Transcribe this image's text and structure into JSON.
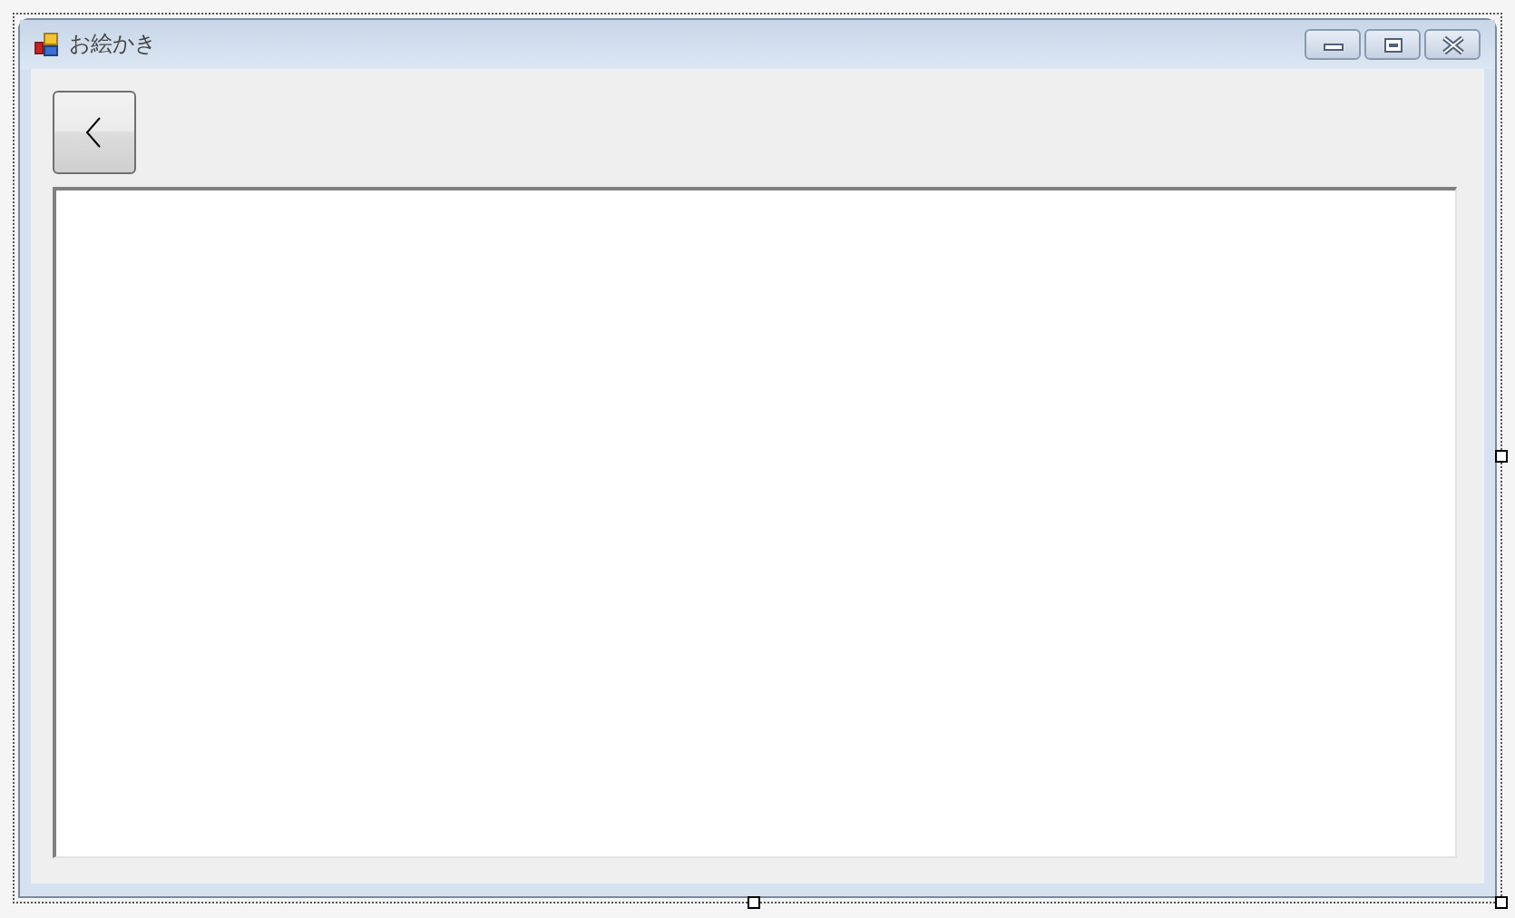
{
  "window": {
    "title": "お絵かき"
  }
}
